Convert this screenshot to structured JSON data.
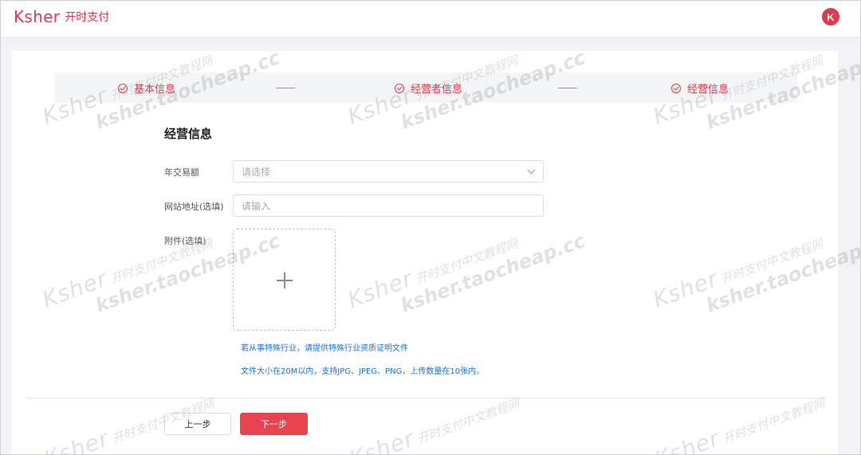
{
  "header": {
    "logo_word": "Ksher",
    "logo_cn": "开时支付",
    "avatar_letter": "K"
  },
  "steps": [
    {
      "label": "基本信息"
    },
    {
      "label": "经营者信息"
    },
    {
      "label": "经营信息"
    }
  ],
  "form": {
    "section_title": "经营信息",
    "annual_volume": {
      "label": "年交易额",
      "placeholder": "请选择"
    },
    "website": {
      "label": "网站地址(选填)",
      "placeholder": "请输入"
    },
    "attachment": {
      "label": "附件(选填)"
    },
    "hint_special": "若从事特殊行业，请提供特殊行业资质证明文件",
    "hint_size": "文件大小在20M以内，支持JPG、JPEG、PNG，上传数量在10张内。"
  },
  "buttons": {
    "prev": "上一步",
    "next": "下一步"
  },
  "watermark": {
    "brand": "Ksher",
    "cn": "开时支付中文教程网",
    "url": "ksher.taocheap.cc"
  },
  "colors": {
    "accent": "#e8374b",
    "hint": "#1a73e8"
  }
}
